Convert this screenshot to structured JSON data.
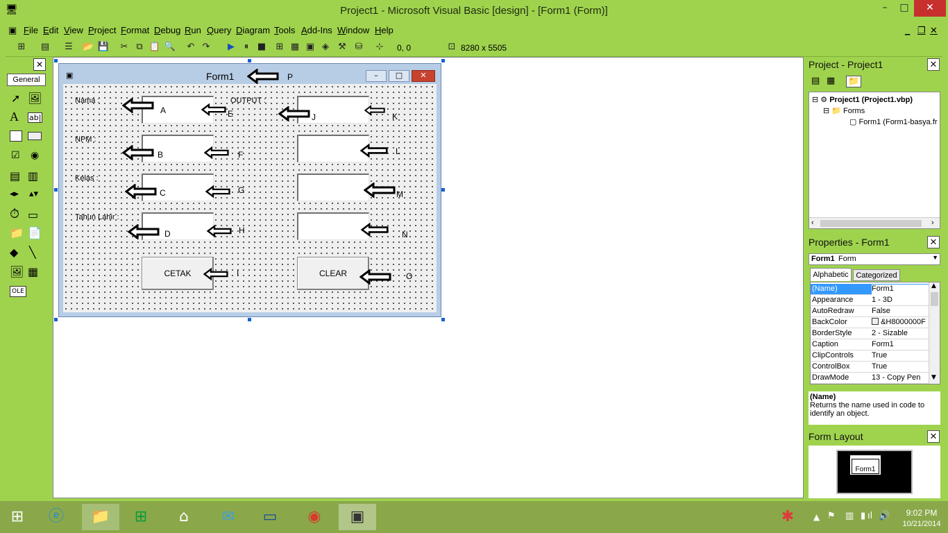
{
  "window": {
    "title": "Project1 - Microsoft Visual Basic [design] - [Form1 (Form)]",
    "min": "–",
    "max": "□",
    "close": "✕"
  },
  "menu": [
    "File",
    "Edit",
    "View",
    "Project",
    "Format",
    "Debug",
    "Run",
    "Query",
    "Diagram",
    "Tools",
    "Add-Ins",
    "Window",
    "Help"
  ],
  "mdi": {
    "min": "_",
    "restore": "❐",
    "close": "✕"
  },
  "toolbar": {
    "position": "0, 0",
    "size": "8280 x 5505"
  },
  "toolbox": {
    "tab": "General",
    "close": "✕"
  },
  "form": {
    "title": "Form1",
    "labels": {
      "nama": "Nama :",
      "npm": "NPM :",
      "kelas": "Kelas :",
      "tahun": "Tahun Lahir :",
      "output": "OUTPUT :"
    },
    "buttons": {
      "cetak": "CETAK",
      "clear": "CLEAR"
    },
    "letters": {
      "A": "A",
      "B": "B",
      "C": "C",
      "D": "D",
      "E": "E",
      "F": "F",
      "G": "G",
      "H": "H",
      "I": "I",
      "J": "J",
      "K": "K",
      "L": "L",
      "M": "M",
      "N": "N",
      "O": "O",
      "P": "P"
    }
  },
  "project": {
    "title": "Project - Project1",
    "root": "Project1 (Project1.vbp)",
    "folder": "Forms",
    "item": "Form1 (Form1-basya.fr"
  },
  "properties": {
    "title": "Properties - Form1",
    "object": "Form1",
    "object_type": "Form",
    "tabs": [
      "Alphabetic",
      "Categorized"
    ],
    "rows": [
      {
        "k": "(Name)",
        "v": "Form1"
      },
      {
        "k": "Appearance",
        "v": "1 - 3D"
      },
      {
        "k": "AutoRedraw",
        "v": "False"
      },
      {
        "k": "BackColor",
        "v": "&H8000000F"
      },
      {
        "k": "BorderStyle",
        "v": "2 - Sizable"
      },
      {
        "k": "Caption",
        "v": "Form1"
      },
      {
        "k": "ClipControls",
        "v": "True"
      },
      {
        "k": "ControlBox",
        "v": "True"
      },
      {
        "k": "DrawMode",
        "v": "13 - Copy Pen"
      }
    ],
    "desc_title": "(Name)",
    "desc_text": "Returns the name used in code to identify an object."
  },
  "layout": {
    "title": "Form Layout",
    "mini_label": "Form1"
  },
  "taskbar": {
    "time": "9:02 PM",
    "date": "10/21/2014"
  },
  "colors": {
    "chrome": "#9fd34e",
    "selection": "#3399ff",
    "taskbar": "#8aa84a"
  }
}
